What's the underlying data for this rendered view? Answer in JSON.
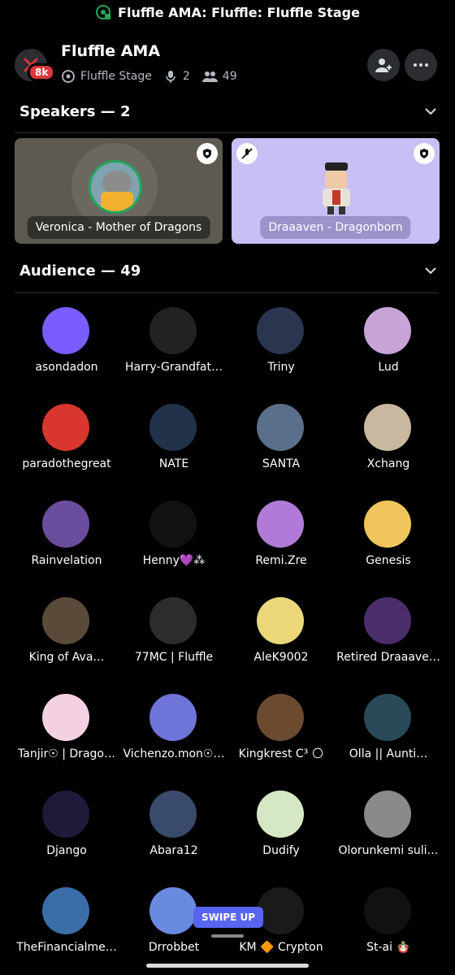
{
  "status": {
    "text": "Fluffle AMA: Fluffle: Fluffle Stage"
  },
  "header": {
    "title": "Fluffle AMA",
    "stage_name": "Fluffle Stage",
    "speakers_count": "2",
    "listeners_count": "49",
    "server_badge": "8k"
  },
  "speakers_section": {
    "label": "Speakers — 2",
    "speakers": [
      {
        "name": "Veronica - Mother of Dragons"
      },
      {
        "name": "Draaaven - Dragonborn"
      }
    ]
  },
  "audience_section": {
    "label": "Audience — 49",
    "members": [
      {
        "name": "asondadon",
        "color": "#7b5cff"
      },
      {
        "name": "Harry-Grandfat…",
        "color": "#222222"
      },
      {
        "name": "Triny",
        "color": "#2a3550"
      },
      {
        "name": "Lud",
        "color": "#c8a3d8"
      },
      {
        "name": "paradothegreat",
        "color": "#d8362f"
      },
      {
        "name": "NATE",
        "color": "#21324a"
      },
      {
        "name": "SANTA",
        "color": "#5a6f8a"
      },
      {
        "name": "Xchang",
        "color": "#c9b8a0"
      },
      {
        "name": "Rainvelation",
        "color": "#6a4d9c"
      },
      {
        "name": "Henny💜⁂",
        "color": "#111111"
      },
      {
        "name": "Remi.Zre",
        "color": "#b27ad8"
      },
      {
        "name": "Genesis",
        "color": "#f0c65c"
      },
      {
        "name": "King of Ava…",
        "color": "#5a4a3a"
      },
      {
        "name": "77MC  | Fluffle",
        "color": "#2c2c2c"
      },
      {
        "name": "AleK9002",
        "color": "#e9d77a"
      },
      {
        "name": "Retired Draaave…",
        "color": "#4a2d6a"
      },
      {
        "name": "Tanjir☉ | Drago…",
        "color": "#f3d1e3"
      },
      {
        "name": "Vichenzo.mon☉…",
        "color": "#6f74d8"
      },
      {
        "name": "Kingkrest C³ 🌕",
        "color": "#6b4a30"
      },
      {
        "name": "Olla ||  Aunti…",
        "color": "#2a4a5a"
      },
      {
        "name": "Django",
        "color": "#1d1a3a"
      },
      {
        "name": "Abara12",
        "color": "#3a4a6a"
      },
      {
        "name": "Dudify",
        "color": "#d6e7c6"
      },
      {
        "name": "Olorunkemi suli…",
        "color": "#8a8a8a"
      },
      {
        "name": "TheFinancialme…",
        "color": "#3b6ea8"
      },
      {
        "name": "Drrobbet",
        "color": "#6a8ae0"
      },
      {
        "name": "KM 🔶 Crypton",
        "color": "#1a1a1a"
      },
      {
        "name": "St-ai 🪆",
        "color": "#111111"
      }
    ]
  },
  "swipe": {
    "label": "SWIPE UP"
  },
  "colors": {
    "accent": "#5865f2",
    "surface": "#2b2d31",
    "speaker1_bg": "#5d5a52",
    "speaker2_bg": "#c8bff5"
  }
}
